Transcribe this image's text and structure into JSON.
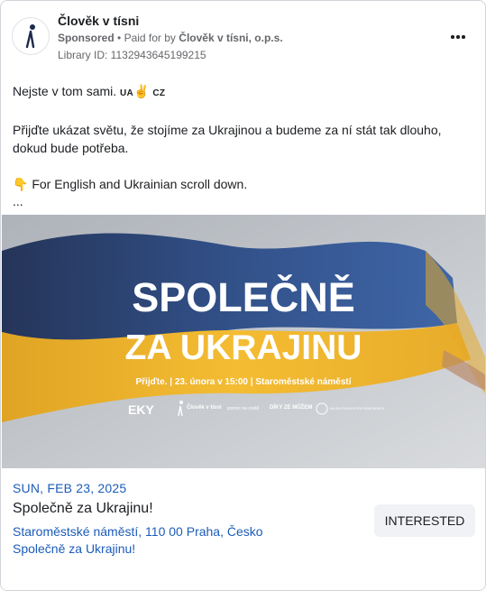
{
  "ad": {
    "page_name": "Člověk v tísni",
    "sponsored": "Sponsored",
    "paid_for": "Paid for by",
    "payer": "Člověk v tísni, o.p.s.",
    "library_id": "Library ID: 1132943645199215",
    "more_icon": "more-horizontal-icon",
    "logo_icon": "people-in-need-logo"
  },
  "body": {
    "line1_text": "Nejste v tom sami.",
    "line1_ua": "UA",
    "line1_emoji": "✌️",
    "line1_cz": "CZ",
    "line2": "Přijďte ukázat světu, že stojíme za Ukrajinou a budeme za ní stát tak dlouho, dokud bude potřeba.",
    "line3_emoji": "👇",
    "line3": "For English and Ukrainian scroll down.",
    "ellipsis": "..."
  },
  "hero": {
    "headline1": "SPOLEČNĚ",
    "headline2": "ZA UKRAJINU",
    "info": "Přijďte. | 23. února v 15:00 | Staroměstské náměstí",
    "logos": [
      "EKY",
      "Člověk v tísni",
      "pomoc na cestě",
      "DÍKY ZE MŮŽEM",
      "MILION CHVILEK PRO DEMOKRACII"
    ],
    "colors": {
      "sky": "#c9ccd0",
      "blue": "#2d4e86",
      "yellow": "#f2b52a",
      "dark": "#1a2640"
    }
  },
  "event": {
    "date": "SUN, FEB 23, 2025",
    "title": "Společně za Ukrajinu!",
    "place": "Staroměstské náměstí, 110 00 Praha, Česko",
    "sub": "Společně za Ukrajinu!",
    "button": "INTERESTED"
  },
  "colors": {
    "link": "#1b5cb8",
    "muted": "#65676b",
    "button_bg": "#f0f2f5"
  }
}
